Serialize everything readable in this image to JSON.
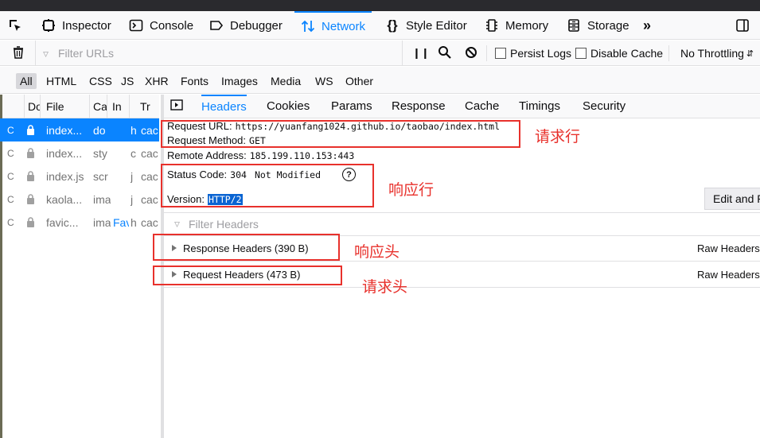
{
  "toolbox": {
    "tools": [
      {
        "label": "Inspector",
        "icon": "inspector-icon"
      },
      {
        "label": "Console",
        "icon": "console-icon"
      },
      {
        "label": "Debugger",
        "icon": "debugger-icon"
      },
      {
        "label": "Network",
        "icon": "network-icon",
        "selected": true
      },
      {
        "label": "Style Editor",
        "icon": "style-editor-icon"
      },
      {
        "label": "Memory",
        "icon": "memory-icon"
      },
      {
        "label": "Storage",
        "icon": "storage-icon"
      }
    ],
    "overflow_icon": "double-chevron-icon",
    "accent": "#0a84ff"
  },
  "network_toolbar": {
    "filter_placeholder": "Filter URLs",
    "persist_logs": "Persist Logs",
    "disable_cache": "Disable Cache",
    "throttling": "No Throttling"
  },
  "type_filters": [
    "All",
    "HTML",
    "CSS",
    "JS",
    "XHR",
    "Fonts",
    "Images",
    "Media",
    "WS",
    "Other"
  ],
  "request_list": {
    "columns": [
      "Do",
      "File",
      "Ca",
      "In",
      "Tr"
    ],
    "rows": [
      {
        "status": "C",
        "file": "index...",
        "cause": "do",
        "init": "h",
        "transferred": "cac",
        "selected": true
      },
      {
        "status": "C",
        "file": "index...",
        "cause": "sty",
        "init": "c",
        "transferred": "cac"
      },
      {
        "status": "C",
        "file": "index.js",
        "cause": "scr",
        "init": "j",
        "transferred": "cac"
      },
      {
        "status": "C",
        "file": "kaola...",
        "cause": "ima",
        "init": "j",
        "transferred": "cac"
      },
      {
        "status": "C",
        "file": "favic...",
        "cause": "ima",
        "init": "Fav",
        "extra": "h",
        "transferred": "cac"
      }
    ]
  },
  "detail_tabs": [
    "Headers",
    "Cookies",
    "Params",
    "Response",
    "Cache",
    "Timings",
    "Security"
  ],
  "headers": {
    "request_url_label": "Request URL:",
    "request_url": "https://yuanfang1024.github.io/taobao/index.html",
    "request_method_label": "Request Method:",
    "request_method": "GET",
    "remote_address_label": "Remote Address:",
    "remote_address": "185.199.110.153:443",
    "status_code_label": "Status Code:",
    "status_code": "304",
    "status_text": "Not Modified",
    "version_label": "Version:",
    "version": "HTTP/2",
    "edit_resend": "Edit and R",
    "filter_placeholder": "Filter Headers",
    "response_headers": "Response Headers (390 B)",
    "request_headers": "Request Headers (473 B)",
    "raw_headers": "Raw Headers"
  },
  "annotations": {
    "request_line": "请求行",
    "status_line": "响应行",
    "response_headers": "响应头",
    "request_headers": "请求头",
    "color": "#e8312c"
  }
}
